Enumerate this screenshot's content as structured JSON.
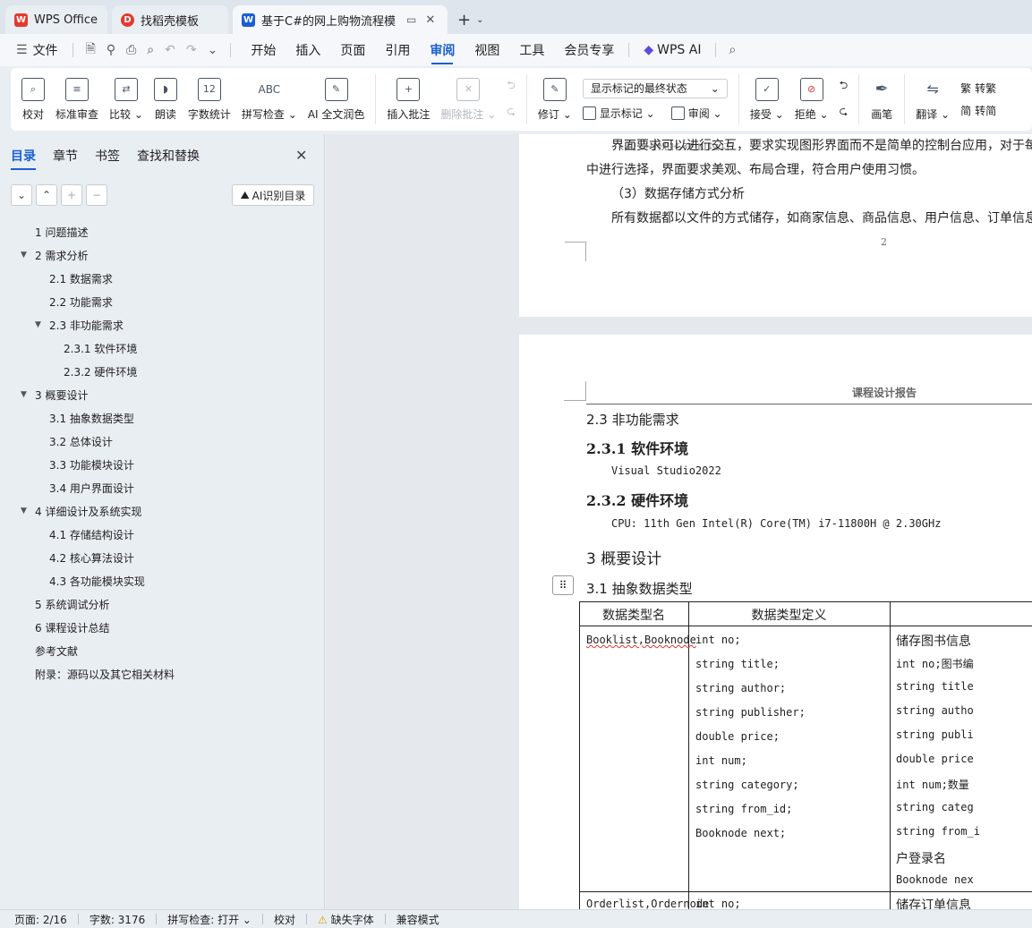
{
  "tabs": [
    {
      "label": "WPS Office",
      "icon": "wps-logo-icon",
      "color": "#e33a2f"
    },
    {
      "label": "找稻壳模板",
      "icon": "docer-icon",
      "color": "#e33a2f"
    },
    {
      "label": "基于C#的网上购物流程模拟",
      "icon": "writer-icon",
      "color": "#1a5fd1"
    }
  ],
  "menu": {
    "file": "文件",
    "items": [
      "开始",
      "插入",
      "页面",
      "引用",
      "审阅",
      "视图",
      "工具",
      "会员专享"
    ],
    "active": "审阅",
    "wps_ai": "WPS AI"
  },
  "ribbon": {
    "proofread": "校对",
    "standard_review": "标准审查",
    "compare": "比较",
    "read_aloud": "朗读",
    "word_count": "字数统计",
    "word_count_icon": "12",
    "spell_check": "拼写检查",
    "spell_icon": "ABC",
    "ai_polish": "AI 全文润色",
    "insert_comment": "插入批注",
    "delete_comment": "删除批注",
    "revise": "修订",
    "markup_state": "显示标记的最终状态",
    "show_markup": "显示标记",
    "review": "审阅",
    "accept": "接受",
    "reject": "拒绝",
    "pen": "画笔",
    "translate": "翻译",
    "to_trad": "转繁",
    "to_simp": "转简"
  },
  "left": {
    "tabs": [
      "目录",
      "章节",
      "书签",
      "查找和替换"
    ],
    "ai_toc": "AI识别目录",
    "toc": [
      {
        "text": "1  问题描述",
        "level": 1
      },
      {
        "text": "2  需求分析",
        "level": 1,
        "expanded": true
      },
      {
        "text": "2.1  数据需求",
        "level": 2
      },
      {
        "text": "2.2  功能需求",
        "level": 2
      },
      {
        "text": "2.3  非功能需求",
        "level": 2,
        "expanded": true
      },
      {
        "text": "2.3.1 软件环境",
        "level": 3
      },
      {
        "text": "2.3.2 硬件环境",
        "level": 3
      },
      {
        "text": "3  概要设计",
        "level": 1,
        "expanded": true
      },
      {
        "text": "3.1 抽象数据类型",
        "level": 2
      },
      {
        "text": "3.2  总体设计",
        "level": 2
      },
      {
        "text": "3.3  功能模块设计",
        "level": 2
      },
      {
        "text": "3.4  用户界面设计",
        "level": 2
      },
      {
        "text": "4  详细设计及系统实现",
        "level": 1,
        "expanded": true
      },
      {
        "text": "4.1  存储结构设计",
        "level": 2
      },
      {
        "text": "4.2  核心算法设计",
        "level": 2
      },
      {
        "text": "4.3  各功能模块实现",
        "level": 2
      },
      {
        "text": "5  系统调试分析",
        "level": 1
      },
      {
        "text": "6  课程设计总结",
        "level": 1
      },
      {
        "text": "参考文献",
        "level": 1
      },
      {
        "text": "附录：源码以及其它相关材料",
        "level": 1
      }
    ]
  },
  "doc": {
    "p1_line1": "界面要求可以进行交互，要求实现图形界面而不是简单的控制台应用，对于每",
    "p1_line2": "中进行选择，界面要求美观、布局合理，符合用户使用习惯。",
    "p1_line3": "（3）数据存储方式分析",
    "p1_line4": "所有数据都以文件的方式储存，如商家信息、商品信息、用户信息、订单信息",
    "page_num": "2",
    "header": "课程设计报告",
    "h_23": "2.3  非功能需求",
    "h_231": "2.3.1 软件环境",
    "sw": "Visual Studio2022",
    "h_232": "2.3.2 硬件环境",
    "hw": "CPU: 11th Gen Intel(R) Core(TM) i7-11800H @ 2.30GHz",
    "h_3": "3  概要设计",
    "h_31": "3.1 抽象数据类型",
    "table": {
      "headers": [
        "数据类型名",
        "数据类型定义",
        ""
      ],
      "row1_name": "Booklist,Booknode",
      "row1_def": [
        "int no;",
        "string title;",
        "string author;",
        "string publisher;",
        "double price;",
        "int num;",
        "string category;",
        "string from_id;",
        "Booknode next;"
      ],
      "row1_desc": [
        "储存图书信息",
        "int no;图书编",
        "string title",
        "string autho",
        "string publi",
        "double price",
        "int num;数量",
        "string categ",
        "string from_i",
        "户登录名",
        "Booknode nex"
      ],
      "row2_name": "Orderlist,Ordernode",
      "row2_def": "int no;",
      "row2_desc": "储存订单信息"
    }
  },
  "status": {
    "page": "页面: 2/16",
    "words": "字数: 3176",
    "spell": "拼写检查: 打开",
    "proof": "校对",
    "font_missing": "缺失字体",
    "compat": "兼容模式"
  }
}
